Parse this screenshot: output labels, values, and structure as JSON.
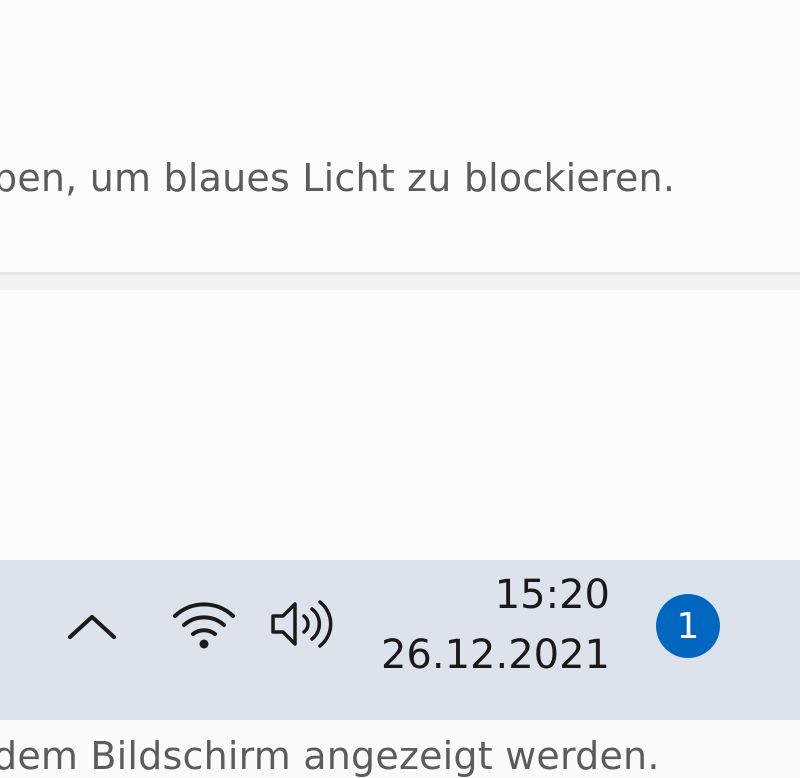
{
  "settings": {
    "night_light_description": "ben, um blaues Licht zu blockieren.",
    "text_size_description": "dem Bildschirm angezeigt werden."
  },
  "taskbar": {
    "tray_icons": [
      "chevron-up-icon",
      "wifi-icon",
      "speaker-icon"
    ],
    "time": "15:20",
    "date": "26.12.2021",
    "notification_count": "1",
    "accent_color": "#0067c0",
    "background_color": "#dde3ec"
  }
}
